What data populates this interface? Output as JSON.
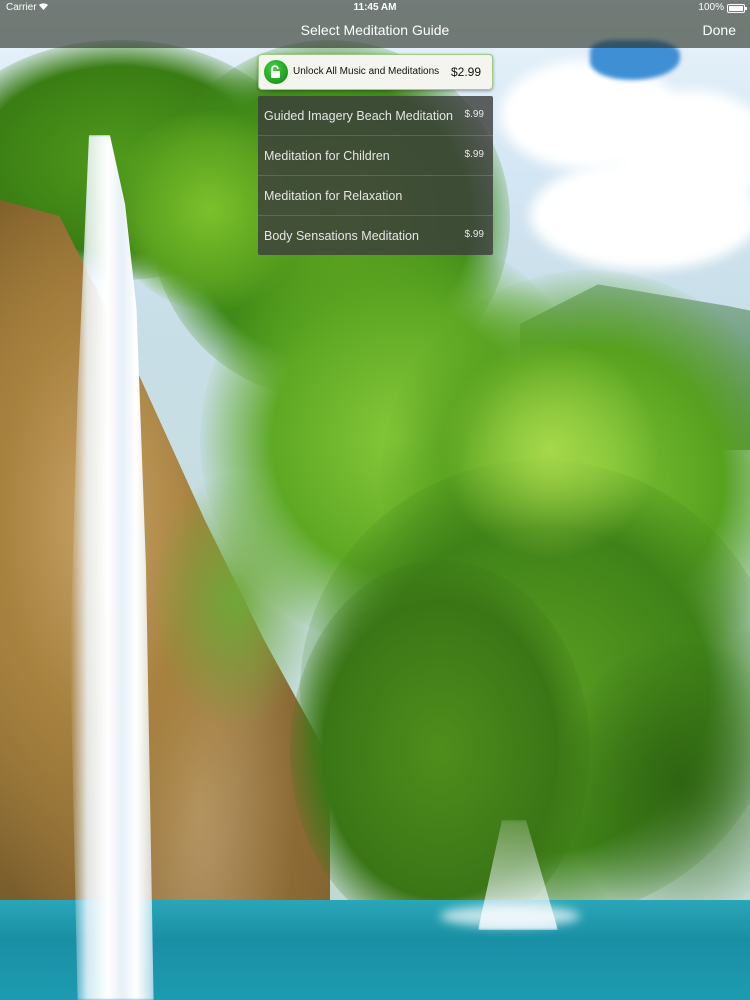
{
  "status_bar": {
    "carrier": "Carrier",
    "time": "11:45 AM",
    "battery": "100%"
  },
  "nav": {
    "title": "Select Meditation Guide",
    "done_label": "Done"
  },
  "unlock_all": {
    "label": "Unlock All Music and Meditations",
    "price": "$2.99",
    "icon": "unlock-icon"
  },
  "guides": [
    {
      "label": "Guided Imagery Beach Meditation",
      "price": "$.99"
    },
    {
      "label": "Meditation for Children",
      "price": "$.99"
    },
    {
      "label": "Meditation for Relaxation",
      "price": ""
    },
    {
      "label": "Body Sensations Meditation",
      "price": "$.99"
    }
  ],
  "colors": {
    "unlock_accent": "#22a322",
    "bar_background": "#283024",
    "list_background": "#3c3e3c"
  }
}
